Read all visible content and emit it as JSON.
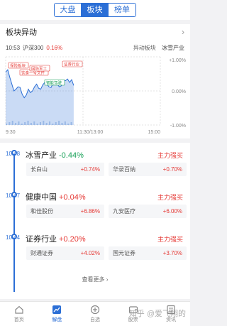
{
  "top_tabs": [
    "大盘",
    "板块",
    "榜单"
  ],
  "active_tab": 1,
  "section": {
    "title": "板块异动"
  },
  "chart_meta": {
    "time": "10:53",
    "index_name": "沪深300",
    "index_change": "0.16%",
    "tag_label": "异动板块",
    "tag_value": "冰雪产业"
  },
  "chart_data": {
    "type": "line",
    "x_ticks": [
      "9:30",
      "11:30/13:00",
      "15:00"
    ],
    "y_ticks": [
      "+1.00%",
      "0.00%",
      "-1.00%"
    ],
    "ylim": [
      -1.0,
      1.0
    ],
    "grid": true,
    "annotations": [
      "保险板块",
      "饮食一号文件",
      "国防军工",
      "智能驾驶",
      "证券行业"
    ],
    "values": [
      0.55,
      0.62,
      0.4,
      0.2,
      0.0,
      0.05,
      0.12,
      0.1,
      -0.1,
      -0.2,
      -0.12,
      0.05,
      -0.05,
      0.0,
      0.12,
      0.2,
      0.08,
      0.05,
      0.18,
      0.25,
      0.2,
      0.12,
      0.1,
      0.22,
      0.28,
      0.2,
      0.12,
      0.15,
      0.32,
      0.3,
      0.35,
      0.25,
      0.33,
      0.16
    ]
  },
  "blocks": [
    {
      "time": "10:48",
      "name": "冰雪产业",
      "change": "-0.44%",
      "dir": "down",
      "badge": "主力强买",
      "stocks": [
        {
          "name": "长白山",
          "change": "+0.74%"
        },
        {
          "name": "华录百纳",
          "change": "+0.70%"
        }
      ]
    },
    {
      "time": "10:47",
      "name": "健康中国",
      "change": "+0.04%",
      "dir": "up",
      "badge": "主力强买",
      "stocks": [
        {
          "name": "和佳股份",
          "change": "+6.86%"
        },
        {
          "name": "九安医疗",
          "change": "+6.00%"
        }
      ]
    },
    {
      "time": "10:44",
      "name": "证券行业",
      "change": "+0.20%",
      "dir": "up",
      "badge": "主力强买",
      "stocks": [
        {
          "name": "财通证券",
          "change": "+4.02%"
        },
        {
          "name": "国元证券",
          "change": "+3.70%"
        }
      ]
    }
  ],
  "more_label": "查看更多",
  "bottom_nav": [
    {
      "label": "首页",
      "icon": "home-icon"
    },
    {
      "label": "解盘",
      "icon": "chart-icon"
    },
    {
      "label": "自选",
      "icon": "plus-circle-icon"
    },
    {
      "label": "股票",
      "icon": "wallet-icon"
    },
    {
      "label": "资讯",
      "icon": "news-icon"
    }
  ],
  "active_nav": 1,
  "watermark": "知乎 @爱飞翔的"
}
